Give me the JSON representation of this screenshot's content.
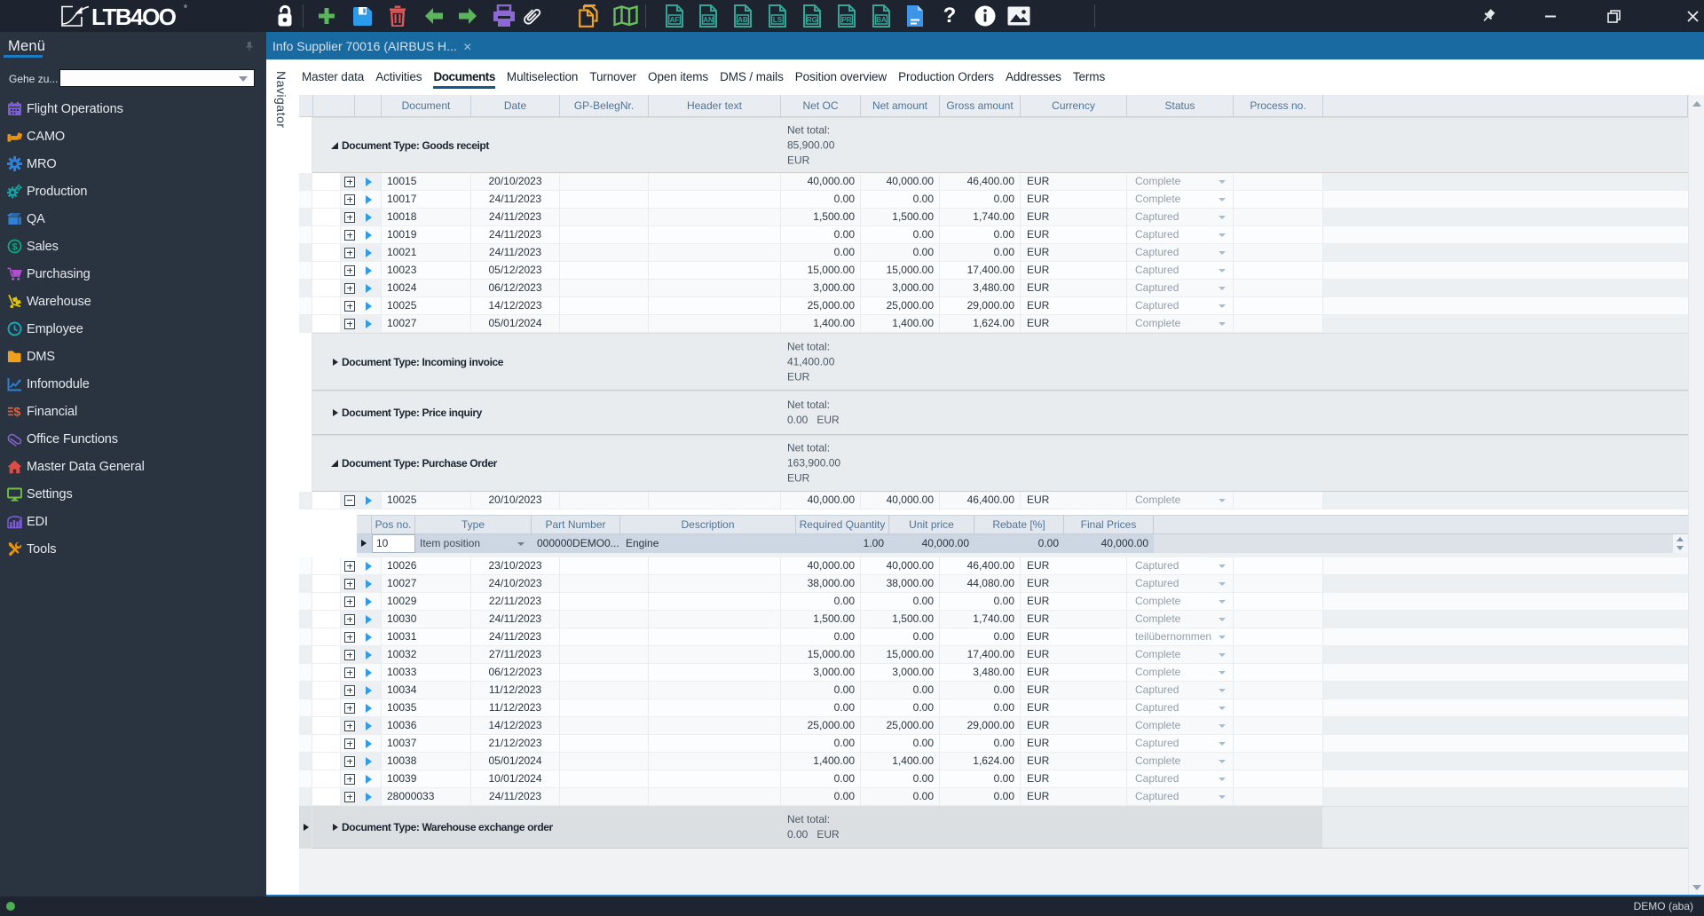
{
  "app_title": "LTB400",
  "toolbar": {
    "icons": [
      {
        "name": "lock"
      },
      {
        "name": "add"
      },
      {
        "name": "save"
      },
      {
        "name": "delete"
      },
      {
        "name": "back"
      },
      {
        "name": "forward"
      },
      {
        "name": "print"
      },
      {
        "name": "attachment"
      },
      {
        "name": "copy"
      },
      {
        "name": "map"
      },
      {
        "name": "doc-af",
        "label": "AF"
      },
      {
        "name": "doc-an",
        "label": "AN"
      },
      {
        "name": "doc-ab",
        "label": "AB"
      },
      {
        "name": "doc-ls",
        "label": "LS"
      },
      {
        "name": "doc-rg",
        "label": "RG"
      },
      {
        "name": "doc-pr",
        "label": "PR"
      },
      {
        "name": "doc-ba",
        "label": "BA"
      },
      {
        "name": "doc-blue"
      },
      {
        "name": "help"
      },
      {
        "name": "info"
      },
      {
        "name": "image"
      }
    ],
    "window_controls": [
      "pin",
      "minimize",
      "restore",
      "close"
    ]
  },
  "sidebar": {
    "title": "Menü",
    "goto_label": "Gehe zu...",
    "goto_value": "",
    "items": [
      {
        "label": "Flight Operations",
        "icon": "calendar",
        "color": "#7e5bd8"
      },
      {
        "label": "CAMO",
        "icon": "connector",
        "color": "#e8930e"
      },
      {
        "label": "MRO",
        "icon": "gear",
        "color": "#2f81d8"
      },
      {
        "label": "Production",
        "icon": "gears",
        "color": "#16a3a3"
      },
      {
        "label": "QA",
        "icon": "box",
        "color": "#2f81d8"
      },
      {
        "label": "Sales",
        "icon": "dollar-circle",
        "color": "#10a585"
      },
      {
        "label": "Purchasing",
        "icon": "cart",
        "color": "#b14fd0"
      },
      {
        "label": "Warehouse",
        "icon": "handtruck",
        "color": "#e2c414"
      },
      {
        "label": "Employee",
        "icon": "clock",
        "color": "#19a8bc"
      },
      {
        "label": "DMS",
        "icon": "folder",
        "color": "#f0a01c"
      },
      {
        "label": "Infomodule",
        "icon": "chart-line",
        "color": "#2f81d8"
      },
      {
        "label": "Financial",
        "icon": "money",
        "color": "#ef5a2e"
      },
      {
        "label": "Office Functions",
        "icon": "paperclip",
        "color": "#8a63d2"
      },
      {
        "label": "Master Data General",
        "icon": "house",
        "color": "#e04b44"
      },
      {
        "label": "Settings",
        "icon": "monitor",
        "color": "#71bd45"
      },
      {
        "label": "EDI",
        "icon": "barchart",
        "color": "#7e5bd8"
      },
      {
        "label": "Tools",
        "icon": "tools",
        "color": "#e8930e"
      }
    ]
  },
  "document_tab": {
    "title": "Info Supplier 70016 (AIRBUS H...",
    "close": "✕"
  },
  "navigator_label": "Navigator",
  "page_tabs": [
    "Master data",
    "Activities",
    "Documents",
    "Multiselection",
    "Turnover",
    "Open items",
    "DMS / mails",
    "Position overview",
    "Production Orders",
    "Addresses",
    "Terms"
  ],
  "active_page_tab": "Documents",
  "grid": {
    "columns": [
      "Document",
      "Date",
      "GP-BelegNr.",
      "Header text",
      "Net OC",
      "Net amount",
      "Gross amount",
      "Currency",
      "Status",
      "Process no."
    ],
    "groups": [
      {
        "label": "Document Type: Goods receipt",
        "expanded": true,
        "net_total": [
          "Net total:",
          "85,900.00",
          "EUR"
        ],
        "rows": [
          {
            "doc": "10015",
            "date": "20/10/2023",
            "net_oc": "40,000.00",
            "net": "40,000.00",
            "gross": "46,400.00",
            "cur": "EUR",
            "status": "Complete"
          },
          {
            "doc": "10017",
            "date": "24/11/2023",
            "net_oc": "0.00",
            "net": "0.00",
            "gross": "0.00",
            "cur": "EUR",
            "status": "Complete"
          },
          {
            "doc": "10018",
            "date": "24/11/2023",
            "net_oc": "1,500.00",
            "net": "1,500.00",
            "gross": "1,740.00",
            "cur": "EUR",
            "status": "Captured"
          },
          {
            "doc": "10019",
            "date": "24/11/2023",
            "net_oc": "0.00",
            "net": "0.00",
            "gross": "0.00",
            "cur": "EUR",
            "status": "Captured"
          },
          {
            "doc": "10021",
            "date": "24/11/2023",
            "net_oc": "0.00",
            "net": "0.00",
            "gross": "0.00",
            "cur": "EUR",
            "status": "Captured"
          },
          {
            "doc": "10023",
            "date": "05/12/2023",
            "net_oc": "15,000.00",
            "net": "15,000.00",
            "gross": "17,400.00",
            "cur": "EUR",
            "status": "Captured"
          },
          {
            "doc": "10024",
            "date": "06/12/2023",
            "net_oc": "3,000.00",
            "net": "3,000.00",
            "gross": "3,480.00",
            "cur": "EUR",
            "status": "Captured"
          },
          {
            "doc": "10025",
            "date": "14/12/2023",
            "net_oc": "25,000.00",
            "net": "25,000.00",
            "gross": "29,000.00",
            "cur": "EUR",
            "status": "Captured"
          },
          {
            "doc": "10027",
            "date": "05/01/2024",
            "net_oc": "1,400.00",
            "net": "1,400.00",
            "gross": "1,624.00",
            "cur": "EUR",
            "status": "Complete"
          }
        ]
      },
      {
        "label": "Document Type: Incoming invoice",
        "expanded": false,
        "net_total": [
          "Net total:",
          "41,400.00",
          "EUR"
        ],
        "rows": []
      },
      {
        "label": "Document Type: Price inquiry",
        "expanded": false,
        "net_total": [
          "Net total:",
          "0.00   EUR"
        ],
        "rows": []
      },
      {
        "label": "Document Type: Purchase Order",
        "expanded": true,
        "net_total": [
          "Net total:",
          "163,900.00",
          "EUR"
        ],
        "rows": [
          {
            "doc": "10025",
            "date": "20/10/2023",
            "net_oc": "40,000.00",
            "net": "40,000.00",
            "gross": "46,400.00",
            "cur": "EUR",
            "status": "Complete",
            "expanded": true,
            "detail": {
              "columns": [
                "Pos no.",
                "Type",
                "Part Number",
                "Description",
                "Required Quantity",
                "Unit price",
                "Rebate [%]",
                "Final Prices"
              ],
              "row": {
                "pos": "10",
                "type": "Item position",
                "part": "000000DEMO0...",
                "desc": "Engine",
                "qty": "1.00",
                "unit": "40,000.00",
                "rebate": "0.00",
                "final": "40,000.00"
              }
            }
          },
          {
            "doc": "10026",
            "date": "23/10/2023",
            "net_oc": "40,000.00",
            "net": "40,000.00",
            "gross": "46,400.00",
            "cur": "EUR",
            "status": "Captured"
          },
          {
            "doc": "10027",
            "date": "24/10/2023",
            "net_oc": "38,000.00",
            "net": "38,000.00",
            "gross": "44,080.00",
            "cur": "EUR",
            "status": "Captured"
          },
          {
            "doc": "10029",
            "date": "22/11/2023",
            "net_oc": "0.00",
            "net": "0.00",
            "gross": "0.00",
            "cur": "EUR",
            "status": "Complete"
          },
          {
            "doc": "10030",
            "date": "24/11/2023",
            "net_oc": "1,500.00",
            "net": "1,500.00",
            "gross": "1,740.00",
            "cur": "EUR",
            "status": "Complete"
          },
          {
            "doc": "10031",
            "date": "24/11/2023",
            "net_oc": "0.00",
            "net": "0.00",
            "gross": "0.00",
            "cur": "EUR",
            "status": "teilübernommen"
          },
          {
            "doc": "10032",
            "date": "27/11/2023",
            "net_oc": "15,000.00",
            "net": "15,000.00",
            "gross": "17,400.00",
            "cur": "EUR",
            "status": "Complete"
          },
          {
            "doc": "10033",
            "date": "06/12/2023",
            "net_oc": "3,000.00",
            "net": "3,000.00",
            "gross": "3,480.00",
            "cur": "EUR",
            "status": "Complete"
          },
          {
            "doc": "10034",
            "date": "11/12/2023",
            "net_oc": "0.00",
            "net": "0.00",
            "gross": "0.00",
            "cur": "EUR",
            "status": "Captured"
          },
          {
            "doc": "10035",
            "date": "11/12/2023",
            "net_oc": "0.00",
            "net": "0.00",
            "gross": "0.00",
            "cur": "EUR",
            "status": "Captured"
          },
          {
            "doc": "10036",
            "date": "14/12/2023",
            "net_oc": "25,000.00",
            "net": "25,000.00",
            "gross": "29,000.00",
            "cur": "EUR",
            "status": "Complete"
          },
          {
            "doc": "10037",
            "date": "21/12/2023",
            "net_oc": "0.00",
            "net": "0.00",
            "gross": "0.00",
            "cur": "EUR",
            "status": "Captured"
          },
          {
            "doc": "10038",
            "date": "05/01/2024",
            "net_oc": "1,400.00",
            "net": "1,400.00",
            "gross": "1,624.00",
            "cur": "EUR",
            "status": "Complete"
          },
          {
            "doc": "10039",
            "date": "10/01/2024",
            "net_oc": "0.00",
            "net": "0.00",
            "gross": "0.00",
            "cur": "EUR",
            "status": "Captured"
          },
          {
            "doc": "28000033",
            "date": "24/11/2023",
            "net_oc": "0.00",
            "net": "0.00",
            "gross": "0.00",
            "cur": "EUR",
            "status": "Captured"
          }
        ]
      },
      {
        "label": "Document Type: Warehouse exchange order",
        "expanded": false,
        "selected": true,
        "net_total": [
          "Net total:",
          "0.00   EUR"
        ],
        "rows": []
      }
    ]
  },
  "statusbar": {
    "user": "DEMO (aba)"
  }
}
